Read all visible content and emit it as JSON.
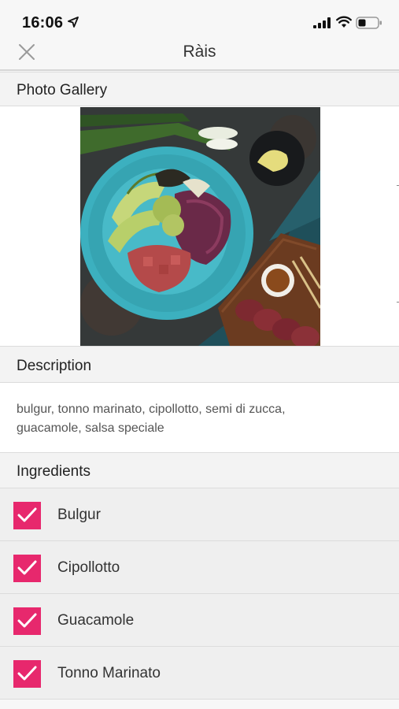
{
  "status_bar": {
    "time": "16:06"
  },
  "nav": {
    "title": "Ràis"
  },
  "sections": {
    "gallery": "Photo Gallery",
    "description": "Description",
    "ingredients": "Ingredients"
  },
  "description": {
    "text": "bulgur, tonno marinato, cipollotto, semi di zucca, guacamole, salsa speciale"
  },
  "ingredients": [
    {
      "label": "Bulgur",
      "checked": true
    },
    {
      "label": "Cipollotto",
      "checked": true
    },
    {
      "label": "Guacamole",
      "checked": true
    },
    {
      "label": "Tonno Marinato",
      "checked": true
    }
  ],
  "icons": {
    "close": "close-icon",
    "location": "location-arrow-icon",
    "signal": "cellular-signal-icon",
    "wifi": "wifi-icon",
    "battery": "battery-icon",
    "check": "checkmark-icon"
  },
  "colors": {
    "accent": "#e7286d",
    "header_bg": "#f3f3f3",
    "row_bg": "#efefef"
  }
}
